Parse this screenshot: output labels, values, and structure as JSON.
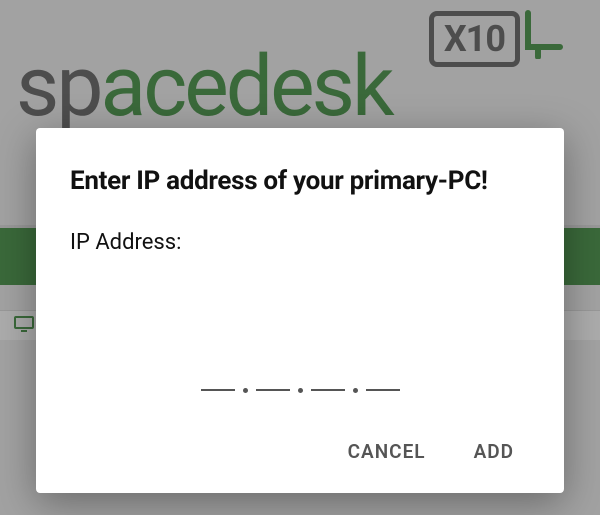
{
  "app": {
    "logo_part1": "sp",
    "logo_part2": "acedesk",
    "badge_text": "X10"
  },
  "dialog": {
    "title": "Enter IP address of your primary-PC!",
    "label": "IP Address:",
    "ip_value": "",
    "cancel_label": "CANCEL",
    "add_label": "ADD"
  }
}
